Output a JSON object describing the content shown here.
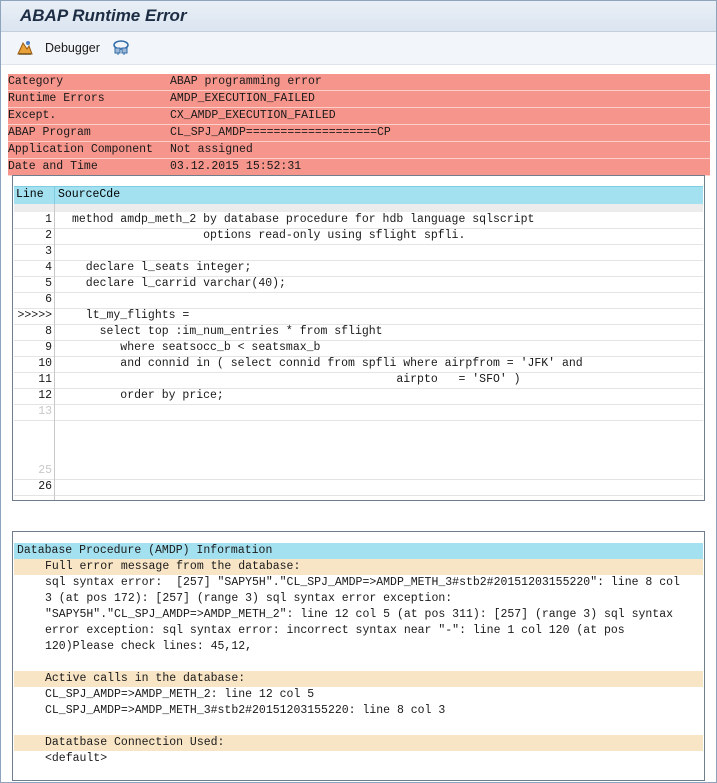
{
  "window": {
    "title": "ABAP Runtime Error"
  },
  "toolbar": {
    "debugger_label": "Debugger"
  },
  "error_info": [
    {
      "key": "Category",
      "value": "ABAP programming error"
    },
    {
      "key": "Runtime Errors",
      "value": "AMDP_EXECUTION_FAILED"
    },
    {
      "key": "Except.",
      "value": "CX_AMDP_EXECUTION_FAILED"
    },
    {
      "key": "ABAP Program",
      "value": "CL_SPJ_AMDP===================CP"
    },
    {
      "key": "Application Component",
      "value": "Not assigned"
    },
    {
      "key": "Date and Time",
      "value": "03.12.2015 15:52:31"
    }
  ],
  "source": {
    "col_line": "Line",
    "col_source": "SourceCde",
    "lines": [
      {
        "num": "1",
        "code": "method amdp_meth_2 by database procedure for hdb language sqlscript"
      },
      {
        "num": "2",
        "code": "                   options read-only using sflight spfli."
      },
      {
        "num": "3",
        "code": ""
      },
      {
        "num": "4",
        "code": "  declare l_seats integer;"
      },
      {
        "num": "5",
        "code": "  declare l_carrid varchar(40);"
      },
      {
        "num": "6",
        "code": ""
      },
      {
        "num": ">>>>>",
        "code": "  lt_my_flights ="
      },
      {
        "num": "8",
        "code": "    select top :im_num_entries * from sflight"
      },
      {
        "num": "9",
        "code": "       where seatsocc_b < seatsmax_b"
      },
      {
        "num": "10",
        "code": "       and connid in ( select connid from spfli where airpfrom = 'JFK' and"
      },
      {
        "num": "11",
        "code": "                                               airpto   = 'SFO' )"
      },
      {
        "num": "12",
        "code": "       order by price;"
      },
      {
        "num": "13",
        "code": ""
      }
    ],
    "trailing_lines": [
      {
        "num": "25",
        "code": ""
      },
      {
        "num": "26",
        "code": ""
      }
    ]
  },
  "amdp": {
    "header": "Database Procedure (AMDP) Information",
    "rows": [
      {
        "type": "sub",
        "text": "Full error message from the database:"
      },
      {
        "type": "text",
        "text": "sql syntax error:  [257] \"SAPY5H\".\"CL_SPJ_AMDP=>AMDP_METH_3#stb2#20151203155220\": line 8 col"
      },
      {
        "type": "text",
        "text": "3 (at pos 172): [257] (range 3) sql syntax error exception:"
      },
      {
        "type": "text",
        "text": "\"SAPY5H\".\"CL_SPJ_AMDP=>AMDP_METH_2\": line 12 col 5 (at pos 311): [257] (range 3) sql syntax"
      },
      {
        "type": "text",
        "text": "error exception: sql syntax error: incorrect syntax near \"-\": line 1 col 120 (at pos"
      },
      {
        "type": "text",
        "text": "120)Please check lines: 45,12,"
      },
      {
        "type": "blank",
        "text": ""
      },
      {
        "type": "sub",
        "text": "Active calls in the database:"
      },
      {
        "type": "text",
        "text": "CL_SPJ_AMDP=>AMDP_METH_2: line 12 col 5"
      },
      {
        "type": "text",
        "text": "CL_SPJ_AMDP=>AMDP_METH_3#stb2#20151203155220: line 8 col 3"
      },
      {
        "type": "blank",
        "text": ""
      },
      {
        "type": "sub",
        "text": "Datatbase Connection Used:"
      },
      {
        "type": "text",
        "text": "<default>"
      }
    ]
  },
  "colors": {
    "error_bg": "#f6958c",
    "header_bg": "#a3e1f0",
    "section_bg": "#f8e5c6"
  }
}
